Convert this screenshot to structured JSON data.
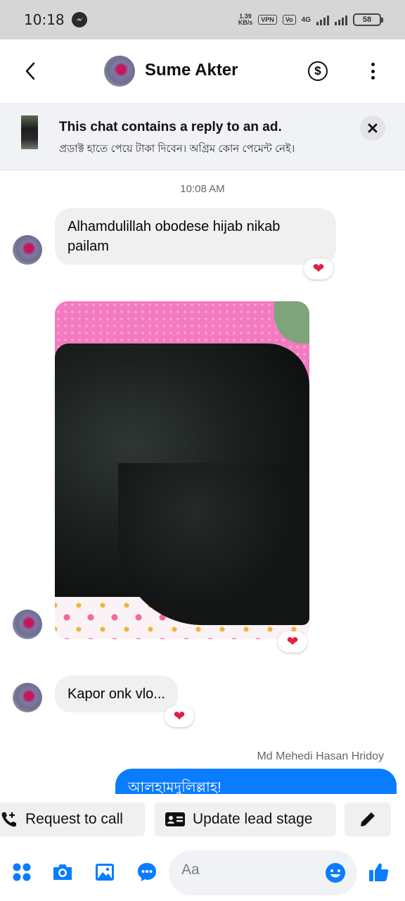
{
  "status_bar": {
    "time": "10:18",
    "net_speed": "1.39\nKB/s",
    "vpn": "VPN",
    "volte": "Vo LTE",
    "network": "4G",
    "battery": "58"
  },
  "header": {
    "contact_name": "Sume Akter"
  },
  "ad_banner": {
    "title": "This chat contains a reply to an ad.",
    "subtitle": "প্রডাক্ট হাতে পেয়ে টাকা দিবেন। অগ্রিম কোন পেমেন্ট নেই।"
  },
  "chat": {
    "timestamp": "10:08 AM",
    "messages": [
      {
        "text": "Alhamdulillah obodese hijab nikab pailam",
        "reaction": "❤"
      },
      {
        "text": "",
        "reaction": "❤"
      },
      {
        "text": "Kapor onk vlo...",
        "reaction": "❤"
      }
    ],
    "outgoing_sender": "Md Mehedi Hasan Hridoy",
    "outgoing_text": "আলহামদুলিল্লাহ!"
  },
  "actions": {
    "request_call": "Request to call",
    "update_lead_stage": "Update lead stage"
  },
  "composer": {
    "placeholder": "Aa"
  },
  "colors": {
    "accent": "#0a7cff",
    "reaction_heart": "#e41e3f"
  }
}
